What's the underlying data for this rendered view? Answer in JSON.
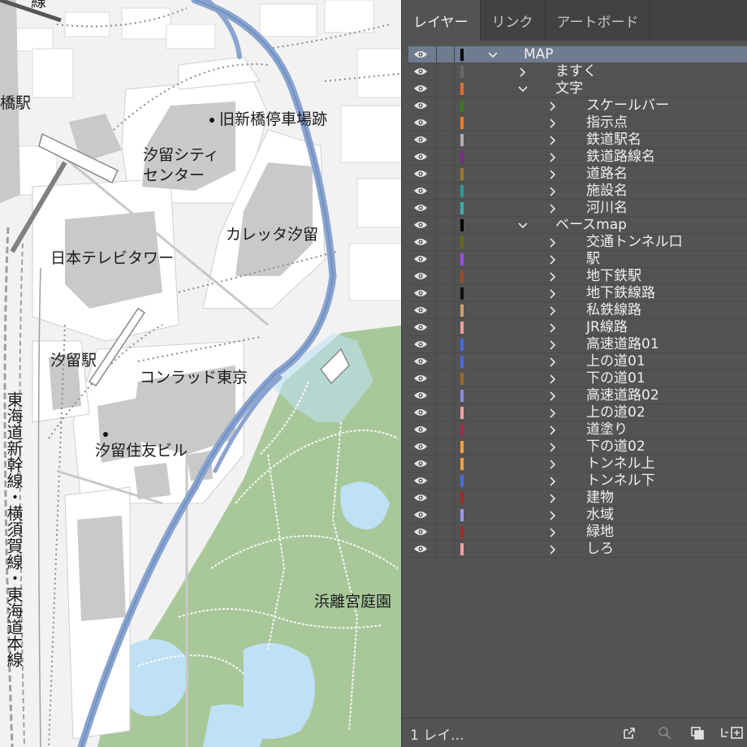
{
  "map": {
    "labels": {
      "shinbashi_eki": "橋駅",
      "kyu_shinbashi": "旧新橋停車場跡",
      "shiodome_city": "汐留シティ",
      "center": "センター",
      "caretta": "カレッタ汐留",
      "ntv": "日本テレビタワー",
      "shiodome_eki": "汐留駅",
      "conrad": "コンラッド東京",
      "sumitomo": "汐留住友ビル",
      "tokaido_line": "東海道新幹線・横須賀線・東海道本線",
      "hamarikyu": "浜離宮庭園",
      "top_line": "線"
    }
  },
  "panel": {
    "tabs": [
      "レイヤー",
      "リンク",
      "アートボード"
    ],
    "active_tab": 0,
    "layers": [
      {
        "name": "MAP",
        "level": 0,
        "expanded": true,
        "color": "#000000",
        "selected": true
      },
      {
        "name": "ますく",
        "level": 1,
        "expanded": false,
        "color": "#6a6a6a"
      },
      {
        "name": "文字",
        "level": 1,
        "expanded": true,
        "color": "#e0702a"
      },
      {
        "name": "スケールバー",
        "level": 2,
        "expanded": false,
        "color": "#3b7a1e"
      },
      {
        "name": "指示点",
        "level": 2,
        "expanded": false,
        "color": "#f07a2a"
      },
      {
        "name": "鉄道駅名",
        "level": 2,
        "expanded": false,
        "color": "#b0b0b0"
      },
      {
        "name": "鉄道路線名",
        "level": 2,
        "expanded": false,
        "color": "#7a2a8a"
      },
      {
        "name": "道路名",
        "level": 2,
        "expanded": false,
        "color": "#9a7a2a"
      },
      {
        "name": "施設名",
        "level": 2,
        "expanded": false,
        "color": "#2a9a9a"
      },
      {
        "name": "河川名",
        "level": 2,
        "expanded": false,
        "color": "#3ab0b0"
      },
      {
        "name": "ベースmap",
        "level": 1,
        "expanded": true,
        "color": "#000000"
      },
      {
        "name": "交通トンネル口",
        "level": 2,
        "expanded": false,
        "color": "#6a6a1a"
      },
      {
        "name": "駅",
        "level": 2,
        "expanded": false,
        "color": "#9a4ae0"
      },
      {
        "name": "地下鉄駅",
        "level": 2,
        "expanded": false,
        "color": "#a04a2a"
      },
      {
        "name": "地下鉄線路",
        "level": 2,
        "expanded": false,
        "color": "#111111"
      },
      {
        "name": "私鉄線路",
        "level": 2,
        "expanded": false,
        "color": "#d0a070"
      },
      {
        "name": "JR線路",
        "level": 2,
        "expanded": false,
        "color": "#f0a0a0"
      },
      {
        "name": "高速道路01",
        "level": 2,
        "expanded": false,
        "color": "#4a6ae0"
      },
      {
        "name": "上の道01",
        "level": 2,
        "expanded": false,
        "color": "#4a6ae0"
      },
      {
        "name": "下の道01",
        "level": 2,
        "expanded": false,
        "color": "#9a6a2a"
      },
      {
        "name": "高速道路02",
        "level": 2,
        "expanded": false,
        "color": "#8a8ae0"
      },
      {
        "name": "上の道02",
        "level": 2,
        "expanded": false,
        "color": "#f0a0a0"
      },
      {
        "name": "道塗り",
        "level": 2,
        "expanded": false,
        "color": "#a02a4a"
      },
      {
        "name": "下の道02",
        "level": 2,
        "expanded": false,
        "color": "#f0a040"
      },
      {
        "name": "トンネル上",
        "level": 2,
        "expanded": false,
        "color": "#f0a040"
      },
      {
        "name": "トンネル下",
        "level": 2,
        "expanded": false,
        "color": "#4a6ae0"
      },
      {
        "name": "建物",
        "level": 2,
        "expanded": false,
        "color": "#a02a2a"
      },
      {
        "name": "水域",
        "level": 2,
        "expanded": false,
        "color": "#9a9af0"
      },
      {
        "name": "緑地",
        "level": 2,
        "expanded": false,
        "color": "#a02a2a"
      },
      {
        "name": "しろ",
        "level": 2,
        "expanded": false,
        "color": "#f0a0a0"
      }
    ],
    "footer": {
      "count": "1 レイ..."
    },
    "icons": [
      "eye-icon",
      "chevron-right-icon",
      "chevron-down-icon",
      "export-icon",
      "search-icon",
      "collect-icon",
      "new-layer-icon"
    ]
  }
}
